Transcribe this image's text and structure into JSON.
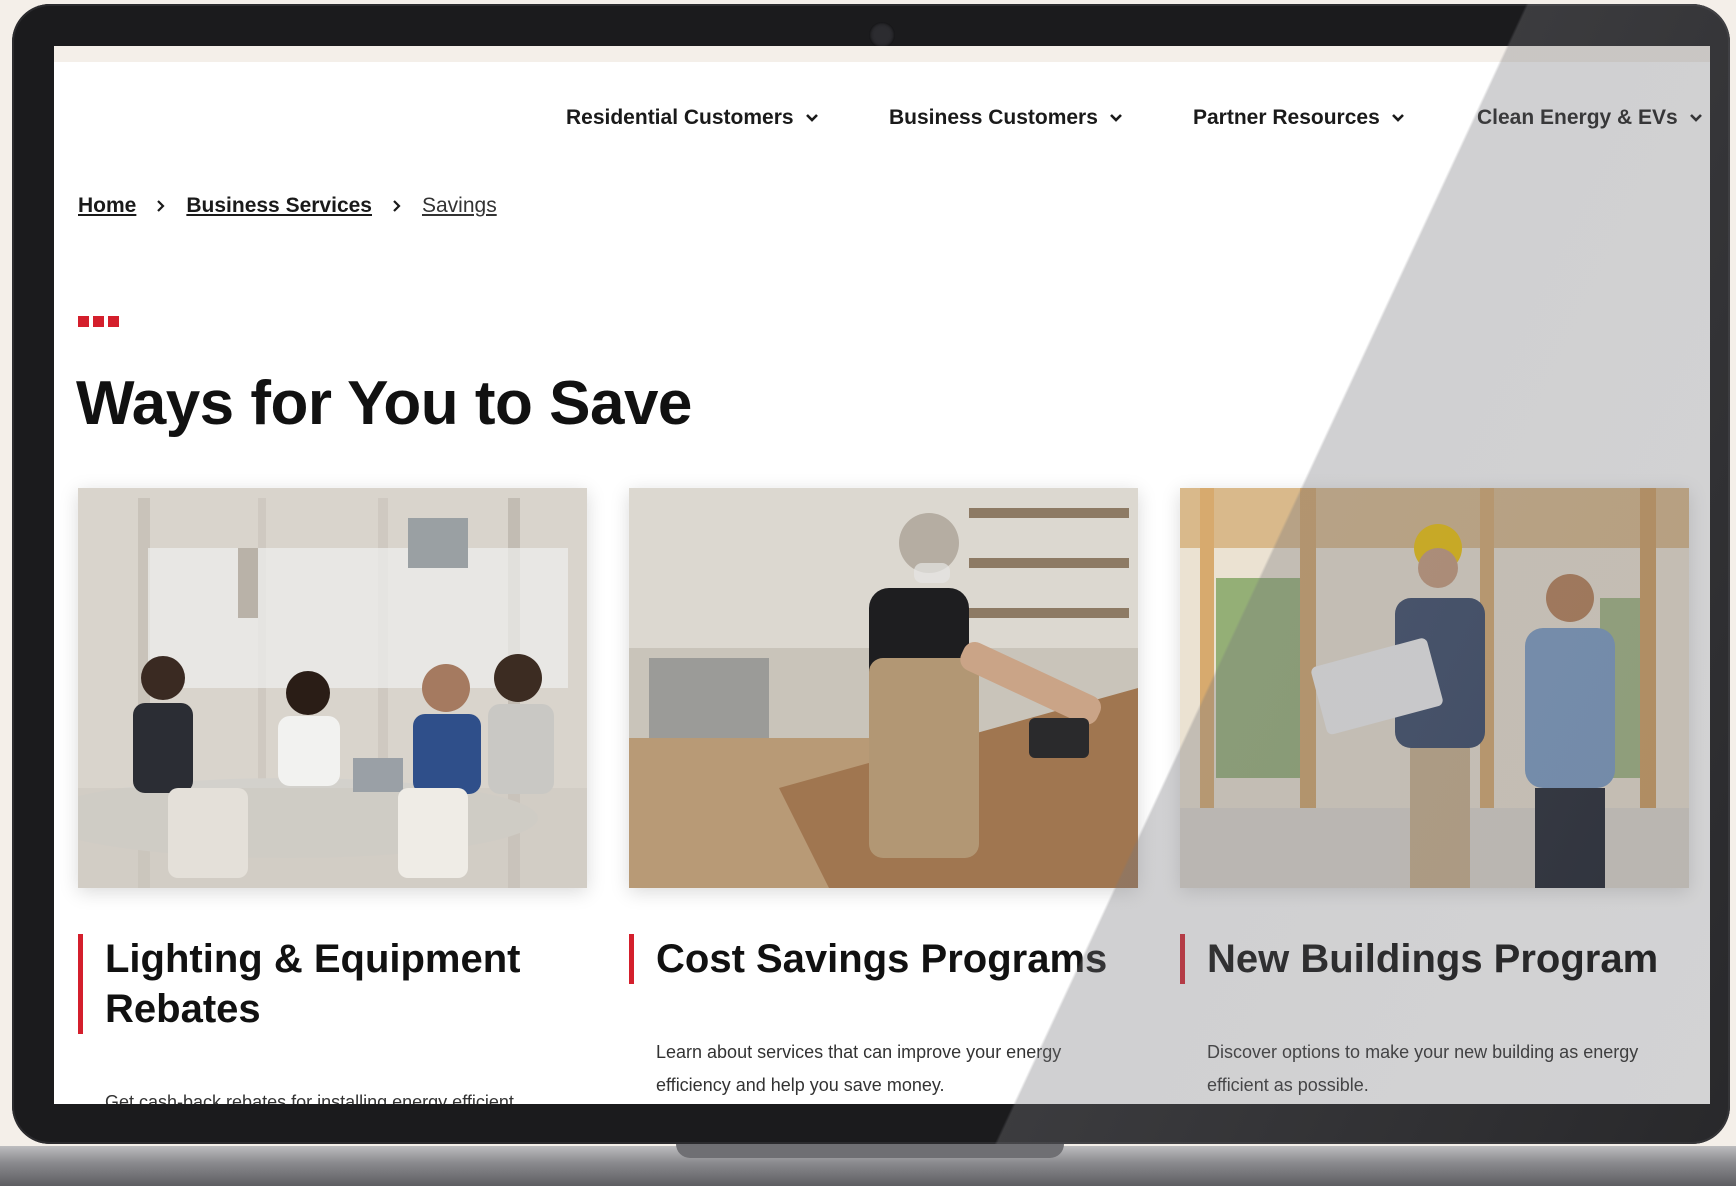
{
  "nav": {
    "items": [
      {
        "label": "Residential Customers"
      },
      {
        "label": "Business Customers"
      },
      {
        "label": "Partner Resources"
      },
      {
        "label": "Clean Energy & EVs"
      }
    ]
  },
  "breadcrumb": {
    "items": [
      {
        "label": "Home"
      },
      {
        "label": "Business Services"
      },
      {
        "label": "Savings"
      }
    ]
  },
  "page": {
    "title": "Ways for You to Save"
  },
  "cards": [
    {
      "title": "Lighting & Equipment Rebates",
      "description": "Get cash-back rebates for installing energy efficient",
      "image": "office-meeting-photo"
    },
    {
      "title": "Cost Savings Programs",
      "description": "Learn about services that can improve your energy efficiency and help you save money.",
      "image": "woodworker-photo"
    },
    {
      "title": "New Buildings Program",
      "description": "Discover options to make your new building as energy efficient as possible.",
      "image": "construction-site-photo"
    }
  ],
  "colors": {
    "accent": "#d41f2c",
    "text": "#111111",
    "background": "#ffffff"
  }
}
